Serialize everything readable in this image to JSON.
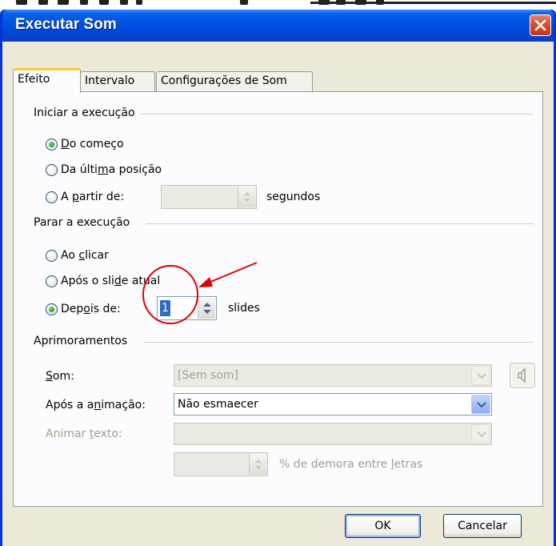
{
  "window": {
    "title": "Executar Som"
  },
  "tabs": [
    {
      "label": "Efeito",
      "active": true
    },
    {
      "label": "Intervalo",
      "active": false
    },
    {
      "label": "Configurações de Som",
      "active": false
    }
  ],
  "start_group": {
    "label": "Iniciar a execução",
    "option_beginning": {
      "pre": "",
      "key": "D",
      "post": "o começo",
      "checked": true
    },
    "option_last": {
      "pre": "Da últi",
      "key": "m",
      "post": "a posição",
      "checked": false
    },
    "option_from": {
      "pre": "A ",
      "key": "p",
      "post": "artir de:",
      "checked": false
    },
    "seconds_unit": "segundos"
  },
  "stop_group": {
    "label": "Parar a execução",
    "option_click": {
      "pre": "Ao ",
      "key": "c",
      "post": "licar",
      "checked": false
    },
    "option_after_slide": {
      "pre": "Após o sli",
      "key": "d",
      "post": "e atual",
      "checked": false
    },
    "option_after": {
      "pre": "Dep",
      "key": "o",
      "post": "is de:",
      "checked": true
    },
    "after_value": "1",
    "slides_unit": "slides"
  },
  "enhancements": {
    "label": "Aprimoramentos",
    "sound": {
      "pre": "",
      "key": "S",
      "post": "om:",
      "value": "[Sem som]"
    },
    "after_animation": {
      "pre": "Após a a",
      "key": "n",
      "post": "imação:",
      "value": "Não esmaecer"
    },
    "animate_text": {
      "pre": "Animar ",
      "key": "t",
      "post": "exto:",
      "value": ""
    },
    "delay_suffix": {
      "pre": "% de demora entre ",
      "key": "l",
      "post": "etras"
    }
  },
  "buttons": {
    "ok": "OK",
    "cancel": "Cancelar"
  },
  "colors": {
    "title_bar": "#0054e3",
    "client_bg": "#ece9d8",
    "annotation": "#e00000",
    "selection": "#316ac5"
  }
}
